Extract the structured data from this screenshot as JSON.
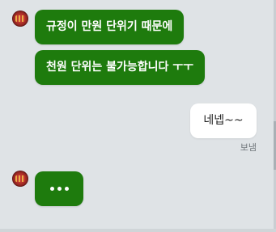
{
  "messages": [
    {
      "sender": "other",
      "text": "규정이 만원 단위기 때문에"
    },
    {
      "sender": "other",
      "text": "천원 단위는 불가능합니다 ㅜㅜ"
    },
    {
      "sender": "me",
      "text": "네넵~~",
      "status": "보냄"
    }
  ],
  "typing_indicator": {
    "dots": 3
  },
  "colors": {
    "background": "#dfe3e6",
    "incoming_bubble": "#1e7b0d",
    "outgoing_bubble": "#ffffff"
  },
  "icons": {
    "avatar": "avatar-icon"
  }
}
